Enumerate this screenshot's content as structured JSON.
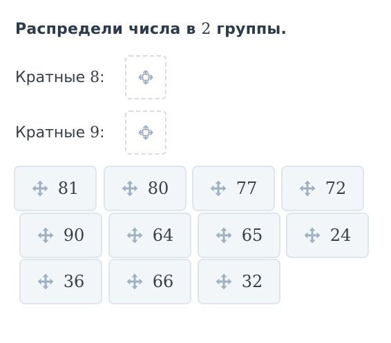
{
  "title": {
    "text_before": "Распредели числа в ",
    "number": "2",
    "text_after": " группы."
  },
  "groups": [
    {
      "label_text": "Кратные ",
      "label_number": "8",
      "label_colon": ":"
    },
    {
      "label_text": "Кратные ",
      "label_number": "9",
      "label_colon": ":"
    }
  ],
  "tiles": [
    "81",
    "80",
    "77",
    "72",
    "90",
    "64",
    "65",
    "24",
    "36",
    "66",
    "32"
  ],
  "colors": {
    "tile_bg": "#f3f6f9",
    "tile_border": "#dfe5ec",
    "icon": "#9fb0c2",
    "dropzone_border": "#d5dbe2"
  },
  "icons": {
    "tile": "move-arrows-icon",
    "dropzone": "drop-target-icon"
  }
}
